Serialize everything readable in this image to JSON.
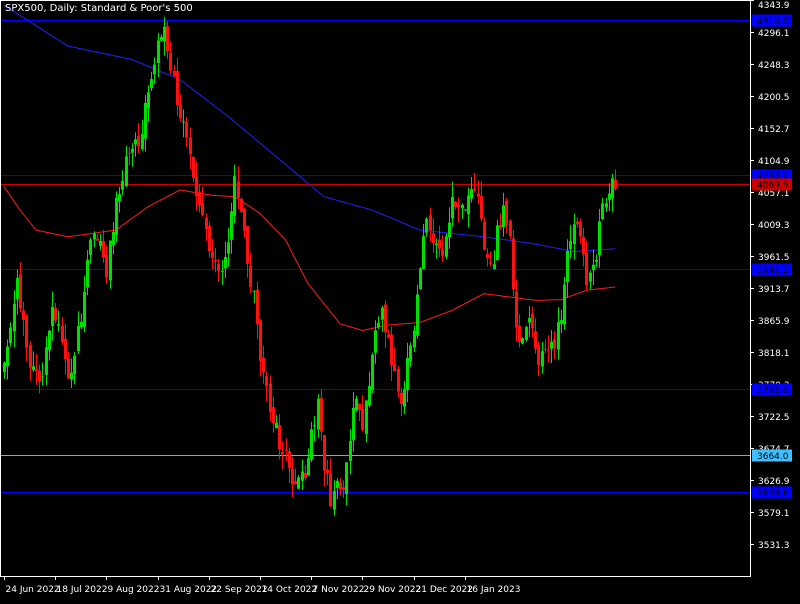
{
  "window": {
    "title": "SPX500, Daily:  Standard & Poor's 500"
  },
  "colors": {
    "background": "#000000",
    "frame": "#ffffff",
    "bull": "#00e000",
    "bear": "#ff1010",
    "ma_slow": "#2020ff",
    "ma_fast": "#ff1a1a",
    "level_blue": "#0000ff",
    "level_red": "#cc0000",
    "level_cyan": "#40bfff",
    "label_text": "#000000"
  },
  "chart_data": {
    "type": "candlestick",
    "title": "SPX500, Daily:  Standard & Poor's 500",
    "ylim": [
      3483,
      4343.9
    ],
    "y_ticks": [
      "4343.9",
      "4296.1",
      "4248.3",
      "4200.5",
      "4152.7",
      "4104.9",
      "4057.1",
      "4009.3",
      "3961.5",
      "3913.7",
      "3865.9",
      "3818.1",
      "3770.3",
      "3722.5",
      "3674.7",
      "3626.9",
      "3579.1",
      "3531.3"
    ],
    "x_labels": [
      "24 Jun 2022",
      "18 Jul 2022",
      "9 Aug 2022",
      "31 Aug 2022",
      "22 Sep 2022",
      "14 Oct 2022",
      "7 Nov 2022",
      "29 Nov 2022",
      "21 Dec 2022",
      "16 Jan 2023"
    ],
    "horizontal_levels": [
      {
        "value": 4314.0,
        "label": "4314.0",
        "color": "#0000ff"
      },
      {
        "value": 4083.0,
        "label": "4083.0",
        "color": "#0000ff"
      },
      {
        "value": 4069.5,
        "label": "4069.5",
        "color": "#cc0000"
      },
      {
        "value": 3941.2,
        "label": "3941.2",
        "color": "#0000ff"
      },
      {
        "value": 3762.6,
        "label": "3762.6",
        "color": "#0000ff"
      },
      {
        "value": 3664.0,
        "label": "3664.0",
        "color": "#40bfff"
      },
      {
        "value": 3608.6,
        "label": "3608.6",
        "color": "#0000ff"
      }
    ],
    "anchors": [
      [
        0,
        3785
      ],
      [
        4,
        3930
      ],
      [
        8,
        3800
      ],
      [
        12,
        3780
      ],
      [
        15,
        3895
      ],
      [
        18,
        3840
      ],
      [
        20,
        3765
      ],
      [
        24,
        3870
      ],
      [
        27,
        3975
      ],
      [
        30,
        3990
      ],
      [
        32,
        3935
      ],
      [
        35,
        4045
      ],
      [
        38,
        4100
      ],
      [
        41,
        4120
      ],
      [
        44,
        4180
      ],
      [
        46,
        4230
      ],
      [
        48,
        4285
      ],
      [
        50,
        4310
      ],
      [
        52,
        4240
      ],
      [
        54,
        4195
      ],
      [
        56,
        4165
      ],
      [
        58,
        4130
      ],
      [
        60,
        4055
      ],
      [
        62,
        4010
      ],
      [
        64,
        3980
      ],
      [
        66,
        3960
      ],
      [
        68,
        3940
      ],
      [
        70,
        3985
      ],
      [
        72,
        4095
      ],
      [
        74,
        4030
      ],
      [
        76,
        3935
      ],
      [
        78,
        3900
      ],
      [
        80,
        3820
      ],
      [
        82,
        3770
      ],
      [
        84,
        3710
      ],
      [
        86,
        3680
      ],
      [
        88,
        3655
      ],
      [
        90,
        3635
      ],
      [
        92,
        3630
      ],
      [
        94,
        3640
      ],
      [
        96,
        3700
      ],
      [
        98,
        3745
      ],
      [
        100,
        3650
      ],
      [
        102,
        3600
      ],
      [
        104,
        3640
      ],
      [
        106,
        3605
      ],
      [
        108,
        3700
      ],
      [
        110,
        3750
      ],
      [
        112,
        3700
      ],
      [
        114,
        3780
      ],
      [
        116,
        3850
      ],
      [
        118,
        3880
      ],
      [
        120,
        3830
      ],
      [
        122,
        3790
      ],
      [
        124,
        3725
      ],
      [
        126,
        3795
      ],
      [
        128,
        3850
      ],
      [
        130,
        3950
      ],
      [
        132,
        4000
      ],
      [
        134,
        3975
      ],
      [
        136,
        3965
      ],
      [
        138,
        3990
      ],
      [
        140,
        4035
      ],
      [
        142,
        4050
      ],
      [
        144,
        4040
      ],
      [
        146,
        4070
      ],
      [
        148,
        4035
      ],
      [
        150,
        3975
      ],
      [
        152,
        3935
      ],
      [
        154,
        3990
      ],
      [
        156,
        4045
      ],
      [
        158,
        3990
      ],
      [
        160,
        3865
      ],
      [
        162,
        3830
      ],
      [
        164,
        3870
      ],
      [
        166,
        3825
      ],
      [
        168,
        3805
      ],
      [
        170,
        3835
      ],
      [
        172,
        3815
      ],
      [
        174,
        3880
      ],
      [
        176,
        3970
      ],
      [
        178,
        4000
      ],
      [
        180,
        3990
      ],
      [
        182,
        3915
      ],
      [
        184,
        3935
      ],
      [
        186,
        4005
      ],
      [
        188,
        4045
      ],
      [
        190,
        4070
      ],
      [
        191,
        4065
      ]
    ],
    "ma_slow_pts": [
      [
        0,
        4336
      ],
      [
        20,
        4275
      ],
      [
        40,
        4255
      ],
      [
        55,
        4225
      ],
      [
        70,
        4170
      ],
      [
        85,
        4110
      ],
      [
        100,
        4050
      ],
      [
        115,
        4030
      ],
      [
        130,
        4000
      ],
      [
        150,
        3990
      ],
      [
        165,
        3980
      ],
      [
        178,
        3968
      ],
      [
        191,
        3972
      ]
    ],
    "ma_fast_pts": [
      [
        0,
        4065
      ],
      [
        5,
        4030
      ],
      [
        10,
        4000
      ],
      [
        20,
        3990
      ],
      [
        35,
        4000
      ],
      [
        45,
        4035
      ],
      [
        55,
        4060
      ],
      [
        65,
        4052
      ],
      [
        72,
        4050
      ],
      [
        80,
        4025
      ],
      [
        88,
        3985
      ],
      [
        95,
        3920
      ],
      [
        100,
        3890
      ],
      [
        105,
        3860
      ],
      [
        112,
        3850
      ],
      [
        120,
        3858
      ],
      [
        130,
        3862
      ],
      [
        140,
        3880
      ],
      [
        150,
        3905
      ],
      [
        158,
        3900
      ],
      [
        166,
        3895
      ],
      [
        174,
        3896
      ],
      [
        182,
        3910
      ],
      [
        191,
        3915
      ]
    ]
  }
}
